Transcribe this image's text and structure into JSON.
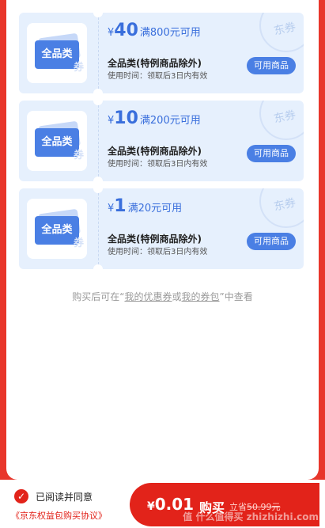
{
  "coupons": [
    {
      "thumb_label": "全品类",
      "thumb_mark": "券",
      "currency": "¥",
      "amount": "40",
      "condition": "满800元可用",
      "scope": "全品类(特例商品除外)",
      "validity": "使用时间：领取后3日内有效",
      "button": "可用商品",
      "stamp": "东券"
    },
    {
      "thumb_label": "全品类",
      "thumb_mark": "券",
      "currency": "¥",
      "amount": "10",
      "condition": "满200元可用",
      "scope": "全品类(特例商品除外)",
      "validity": "使用时间：领取后3日内有效",
      "button": "可用商品",
      "stamp": "东券"
    },
    {
      "thumb_label": "全品类",
      "thumb_mark": "券",
      "currency": "¥",
      "amount": "1",
      "condition": "满20元可用",
      "scope": "全品类(特例商品除外)",
      "validity": "使用时间：领取后3日内有效",
      "button": "可用商品",
      "stamp": "东券"
    }
  ],
  "hint": {
    "prefix": "购买后可在“",
    "link1": "我的优惠券",
    "middle": "或",
    "link2": "我的券包",
    "suffix": "”中查看"
  },
  "footer": {
    "check_icon": "checkmark-icon",
    "agree_text": "已阅读并同意",
    "agreement_link": "《京东权益包购买协议》",
    "buy": {
      "currency": "¥",
      "price": "0.01",
      "label": "购买",
      "original_prefix": "立省",
      "original_price": "50.99元"
    }
  },
  "watermark": "值 什么值得买 zhizhizhi.com"
}
